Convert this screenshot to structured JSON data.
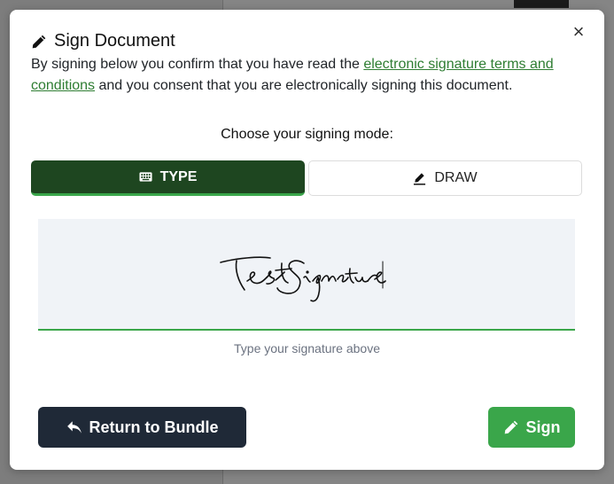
{
  "modal": {
    "title": "Sign Document",
    "intro_before": "By signing below you confirm that you have read the ",
    "intro_link": "electronic signature terms and conditions",
    "intro_after": " and you consent that you are electronically signing this document.",
    "mode_label": "Choose your signing mode:",
    "tabs": {
      "type_label": "TYPE",
      "draw_label": "DRAW",
      "active": "TYPE"
    },
    "signature_value": "Test Signature",
    "hint": "Type your signature above",
    "return_label": "Return to Bundle",
    "sign_label": "Sign",
    "close_glyph": "×"
  },
  "colors": {
    "accent_green": "#3aa64a",
    "tab_active_bg": "#1e4620",
    "return_button_bg": "#1f2937",
    "link": "#2e7d32"
  },
  "icons": {
    "title": "pencil-icon",
    "type_tab": "keyboard-icon",
    "draw_tab": "pen-icon",
    "return": "reply-arrow-icon",
    "sign": "pencil-icon",
    "close": "close-icon"
  }
}
